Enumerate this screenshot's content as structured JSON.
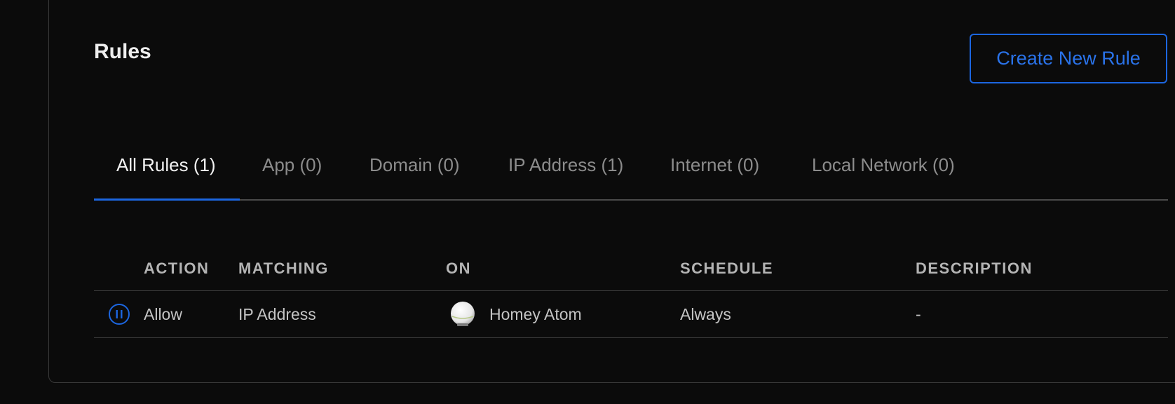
{
  "header": {
    "title": "Rules",
    "create_button_label": "Create New Rule"
  },
  "tabs": [
    {
      "label": "All Rules (1)",
      "active": true
    },
    {
      "label": "App (0)",
      "active": false
    },
    {
      "label": "Domain (0)",
      "active": false
    },
    {
      "label": "IP Address (1)",
      "active": false
    },
    {
      "label": "Internet (0)",
      "active": false
    },
    {
      "label": "Local Network (0)",
      "active": false
    }
  ],
  "table": {
    "columns": [
      "ACTION",
      "MATCHING",
      "ON",
      "SCHEDULE",
      "DESCRIPTION"
    ],
    "rows": [
      {
        "status_icon": "pause-circle-icon",
        "action": "Allow",
        "matching": "IP Address",
        "device_icon": "homey-atom-device-icon",
        "on": "Homey Atom",
        "schedule": "Always",
        "description": "-"
      }
    ]
  },
  "colors": {
    "accent": "#1c66e0",
    "background": "#0b0b0b"
  }
}
